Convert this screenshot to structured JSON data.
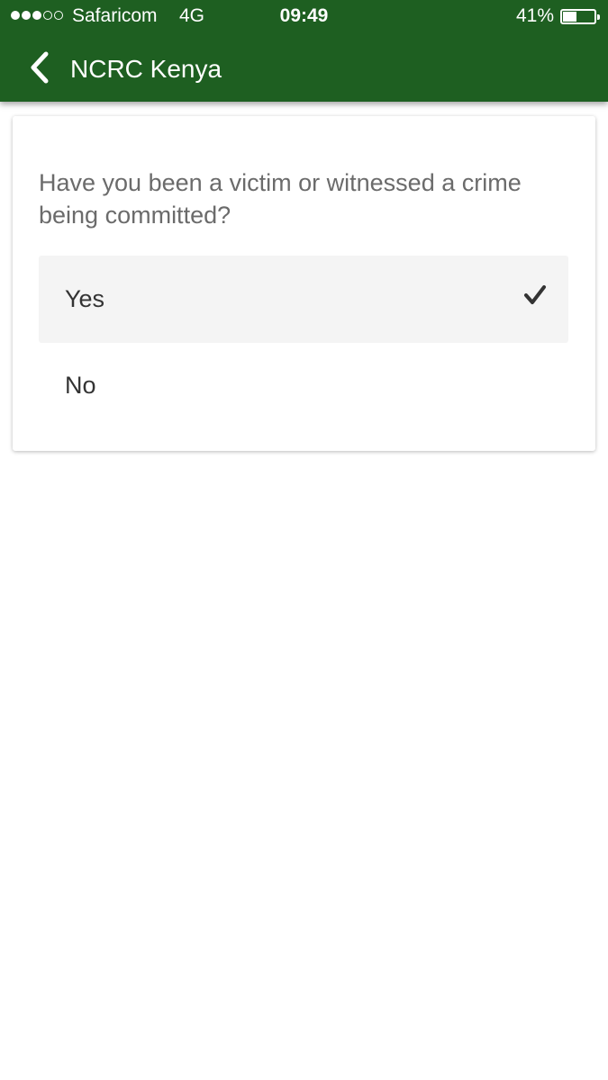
{
  "status_bar": {
    "carrier": "Safaricom",
    "network": "4G",
    "time": "09:49",
    "battery_percent": "41%",
    "battery_level": 0.41
  },
  "header": {
    "back_icon": "chevron-left-icon",
    "title": "NCRC Kenya",
    "color": "#1e5f21"
  },
  "question": {
    "text": "Have you been a victim or witnessed a crime being committed?",
    "options": [
      {
        "label": "Yes",
        "selected": true
      },
      {
        "label": "No",
        "selected": false
      }
    ],
    "selected_icon": "checkmark-icon"
  }
}
